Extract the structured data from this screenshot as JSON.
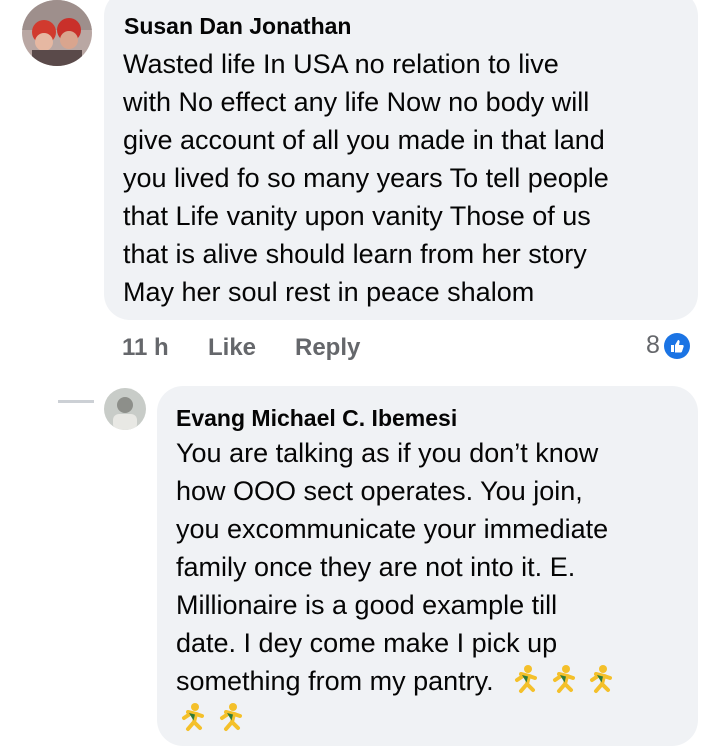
{
  "comment1": {
    "author": "Susan Dan Jonathan",
    "lines": [
      "Wasted  life In USA  no relation  to live",
      "with No effect  any life Now no body will",
      "give account  of all you made in that land",
      "you lived fo so many years To tell people",
      "that Life vanity upon  vanity Those of us",
      "that is alive should learn from her story",
      "May her soul rest in peace shalom"
    ],
    "time": "11 h",
    "like_label": "Like",
    "reply_label": "Reply",
    "reaction_count": "8",
    "reaction_icon": "thumbs-up-icon",
    "reaction_color": "#1b74e4"
  },
  "comment2": {
    "author": "Evang Michael C. Ibemesi",
    "lines": [
      "You are talking as if you don’t know",
      "how OOO sect operates. You join,",
      "you excommunicate your immediate",
      "family once they are not into it. E.",
      "Millionaire is a good example till",
      "date. I dey come make I pick up",
      "something from my pantry."
    ],
    "emoji_icon": "person-running-emoji"
  },
  "colors": {
    "bubble": "#f0f2f5",
    "secondary_text": "#65676b",
    "accent": "#1b74e4"
  }
}
